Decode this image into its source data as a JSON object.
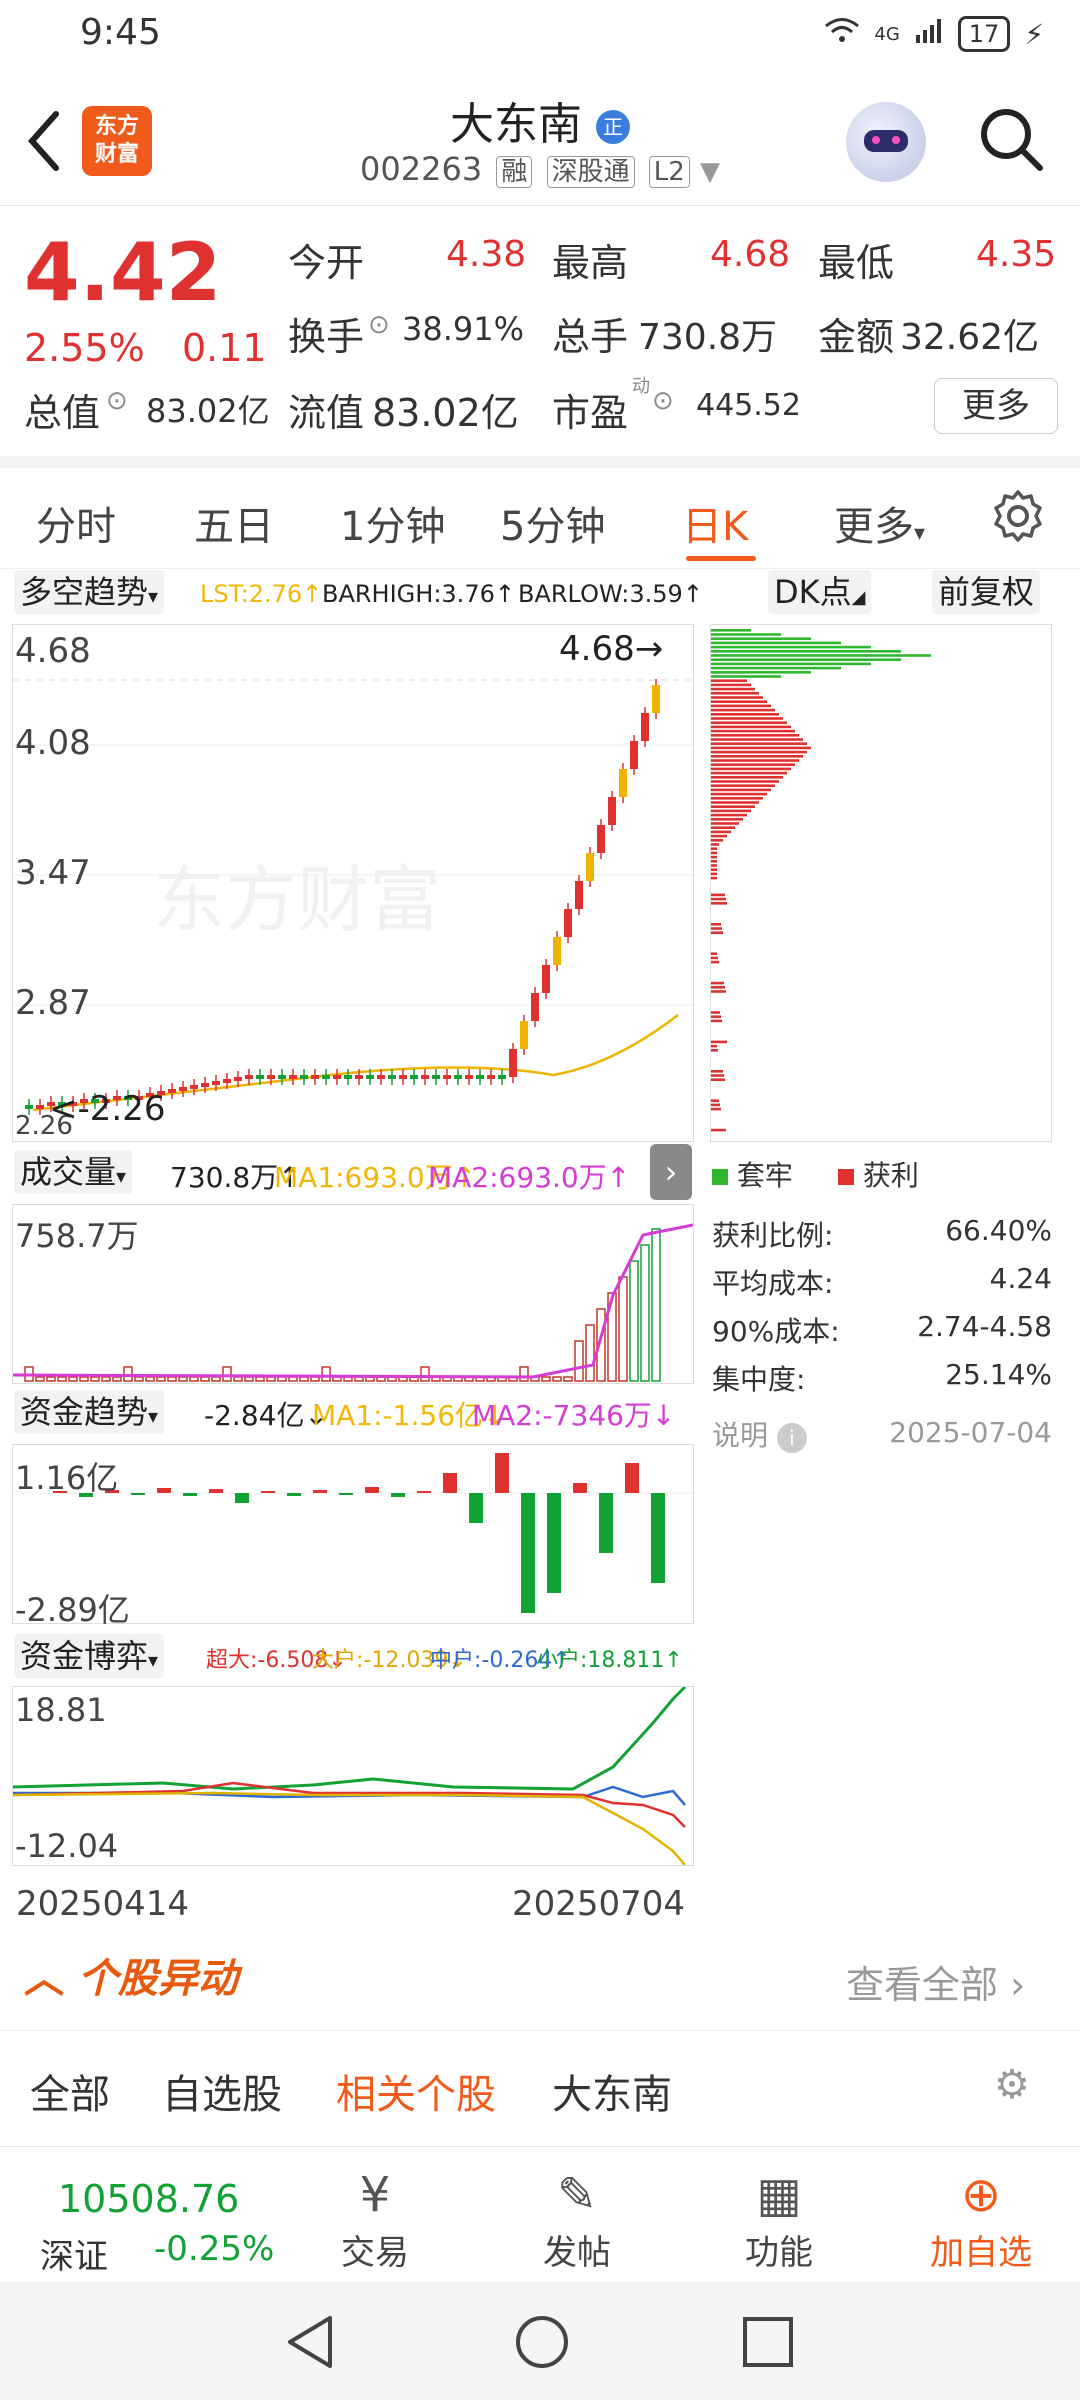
{
  "status_bar": {
    "time": "9:45",
    "network": "4G",
    "battery": "17"
  },
  "header": {
    "logo_text": "东方\n财富",
    "stock_name": "大东南",
    "stock_badge": "正",
    "stock_code": "002263",
    "tags": [
      "融",
      "深股通",
      "L2"
    ]
  },
  "summary": {
    "price": "4.42",
    "change_pct": "2.55%",
    "change_amt": "0.11",
    "open_label": "今开",
    "open": "4.38",
    "high_label": "最高",
    "high": "4.68",
    "low_label": "最低",
    "low": "4.35",
    "turnover_label": "换手",
    "turnover": "38.91%",
    "volume_label": "总手",
    "volume": "730.8万",
    "amount_label": "金额",
    "amount": "32.62亿",
    "mcap_label": "总值",
    "mcap": "83.02亿",
    "float_label": "流值",
    "float": "83.02亿",
    "pe_label": "市盈",
    "pe_sup": "动",
    "pe": "445.52",
    "more_label": "更多"
  },
  "period_tabs": [
    "分时",
    "五日",
    "1分钟",
    "5分钟",
    "日K",
    "更多"
  ],
  "kline": {
    "indicator_select": "多空趋势",
    "lst": "LST:2.76↑",
    "barhigh": "BARHIGH:3.76↑",
    "barlow": "BARLOW:3.59↑",
    "dk_label": "DK点",
    "adjust_label": "前复权",
    "y_labels": [
      "4.68",
      "4.08",
      "3.47",
      "2.87",
      "2.26"
    ],
    "max_marker": "4.68",
    "min_marker": "2.26",
    "watermark": "东方财富"
  },
  "chip": {
    "legend_trapped": "套牢",
    "legend_profit": "获利",
    "stats": [
      {
        "label": "获利比例:",
        "value": "66.40%"
      },
      {
        "label": "平均成本:",
        "value": "4.24"
      },
      {
        "label": "90%成本:",
        "value": "2.74-4.58"
      },
      {
        "label": "集中度:",
        "value": "25.14%"
      }
    ],
    "note_label": "说明",
    "date": "2025-07-04"
  },
  "volume": {
    "select": "成交量",
    "value": "730.8万↑",
    "ma1": "MA1:693.0万↑",
    "ma2": "MA2:693.0万↑",
    "y_top": "758.7万"
  },
  "fund_trend": {
    "select": "资金趋势",
    "value": "-2.84亿↓",
    "ma1": "MA1:-1.56亿↓",
    "ma2": "MA2:-7346万↓",
    "y_top": "1.16亿",
    "y_bottom": "-2.89亿"
  },
  "fund_game": {
    "select": "资金博弈",
    "super": "超大:-6.508↓",
    "large": "大户:-12.039↓",
    "mid": "中户:-0.264↑",
    "small": "小户:18.811↑",
    "y_top": "18.81",
    "y_bottom": "-12.04"
  },
  "dates": {
    "start": "20250414",
    "end": "20250704"
  },
  "movement": {
    "title": "个股异动",
    "view_all": "查看全部",
    "tabs": [
      "全部",
      "自选股",
      "相关个股",
      "大东南"
    ]
  },
  "bottom_bar": {
    "index_value": "10508.76",
    "index_name": "深证",
    "index_change": "-0.25%",
    "items": [
      "交易",
      "发帖",
      "功能",
      "加自选"
    ]
  },
  "colors": {
    "up": "#e03131",
    "down": "#12a134",
    "accent": "#f05a1a"
  }
}
